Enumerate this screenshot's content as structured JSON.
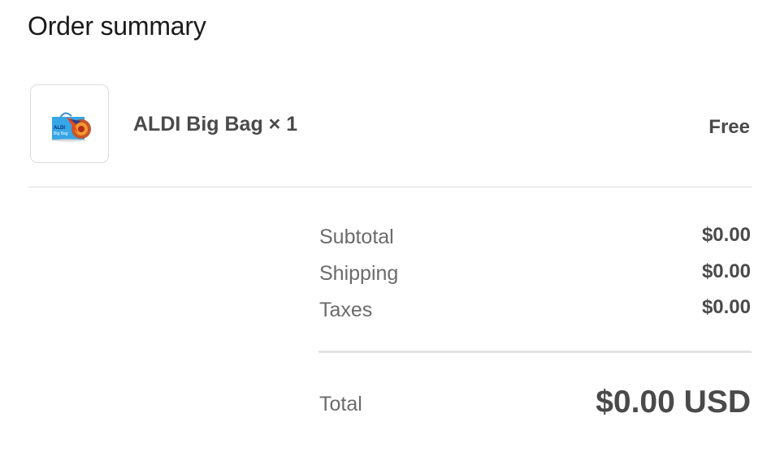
{
  "order_summary": {
    "title": "Order summary",
    "item": {
      "name": "ALDI Big Bag × 1",
      "price": "Free",
      "thumbnail": {
        "icon": "tote-bag-image",
        "brand_text": "ALDI",
        "subtitle_text": "Big Bag"
      }
    },
    "costs": [
      {
        "label": "Subtotal",
        "value": "$0.00"
      },
      {
        "label": "Shipping",
        "value": "$0.00"
      },
      {
        "label": "Taxes",
        "value": "$0.00"
      }
    ],
    "total": {
      "label": "Total",
      "value": "$0.00 USD"
    }
  },
  "colors": {
    "bag_blue": "#36a6e6",
    "bag_accent": "#e8491d",
    "text_primary": "#4a4a4a",
    "text_muted": "#6b6b6b",
    "divider": "#dedede"
  }
}
